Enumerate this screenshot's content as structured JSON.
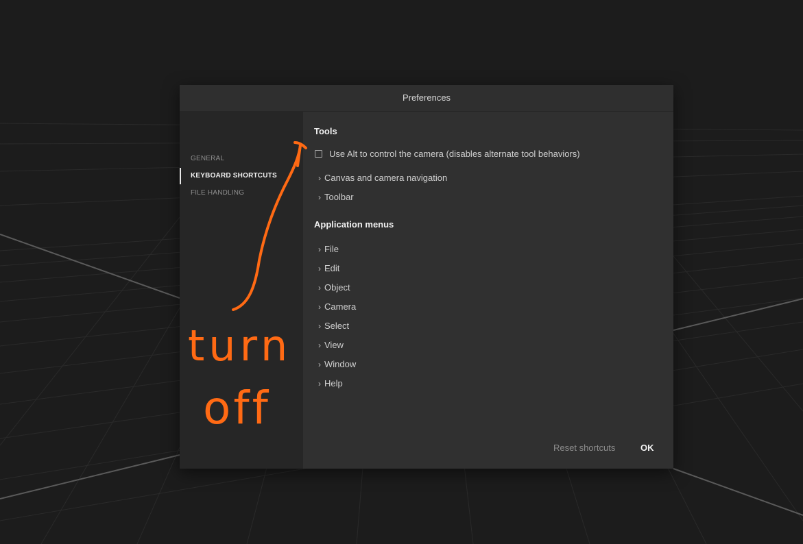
{
  "dialog": {
    "title": "Preferences"
  },
  "sidebar": {
    "items": [
      {
        "label": "GENERAL",
        "active": false
      },
      {
        "label": "KEYBOARD SHORTCUTS",
        "active": true
      },
      {
        "label": "FILE HANDLING",
        "active": false
      }
    ]
  },
  "tools": {
    "title": "Tools",
    "alt_camera_label": "Use Alt to control the camera (disables alternate tool behaviors)",
    "alt_camera_checked": false,
    "groups": [
      {
        "label": "Canvas and camera navigation"
      },
      {
        "label": "Toolbar"
      }
    ]
  },
  "menus": {
    "title": "Application menus",
    "groups": [
      {
        "label": "File"
      },
      {
        "label": "Edit"
      },
      {
        "label": "Object"
      },
      {
        "label": "Camera"
      },
      {
        "label": "Select"
      },
      {
        "label": "View"
      },
      {
        "label": "Window"
      },
      {
        "label": "Help"
      }
    ]
  },
  "footer": {
    "reset_label": "Reset shortcuts",
    "ok_label": "OK"
  },
  "annotation": {
    "line1": "turn",
    "line2": "off",
    "color": "#ff6a14"
  },
  "chevron_glyph": "›"
}
